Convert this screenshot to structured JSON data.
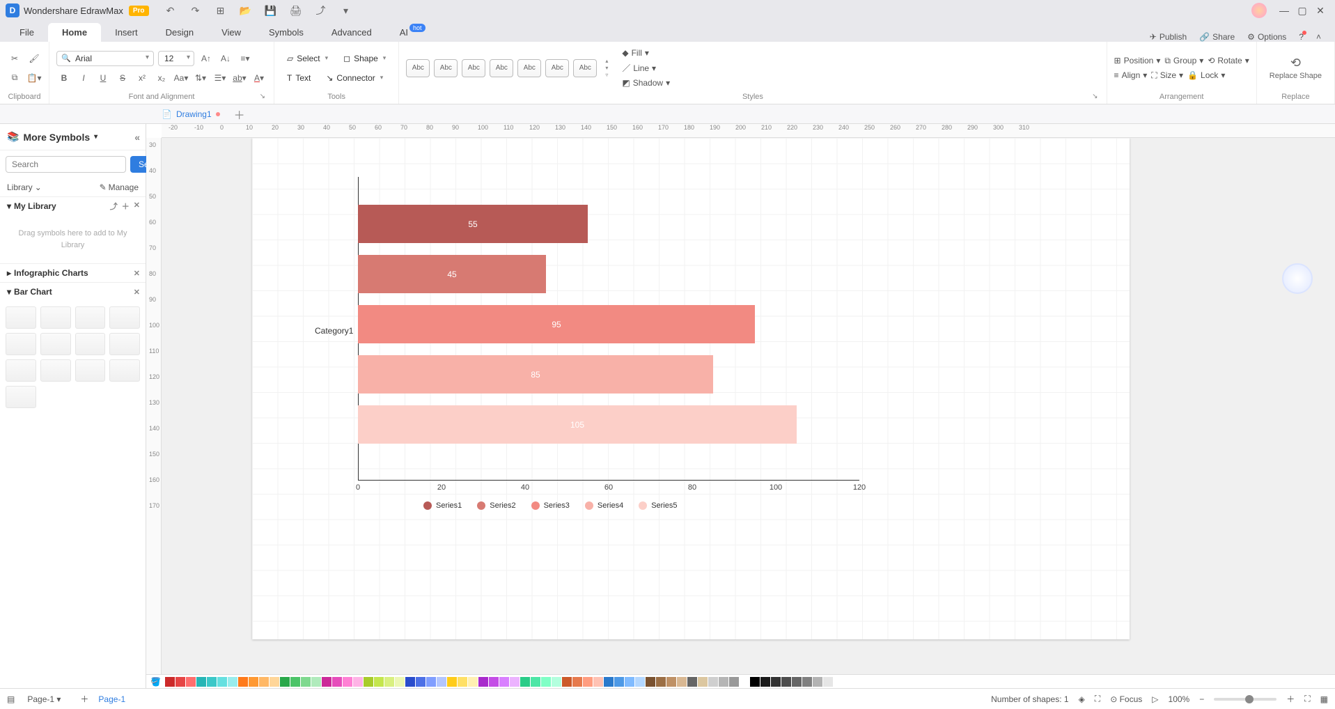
{
  "app": {
    "title": "Wondershare EdrawMax",
    "pro": "Pro"
  },
  "menu": {
    "file": "File",
    "home": "Home",
    "insert": "Insert",
    "design": "Design",
    "view": "View",
    "symbols": "Symbols",
    "advanced": "Advanced",
    "ai": "AI",
    "ai_badge": "hot",
    "publish": "Publish",
    "share": "Share",
    "options": "Options"
  },
  "ribbon": {
    "clipboard": "Clipboard",
    "font_name": "Arial",
    "font_size": "12",
    "font_group": "Font and Alignment",
    "select": "Select",
    "shape": "Shape",
    "text": "Text",
    "connector": "Connector",
    "tools": "Tools",
    "style_swatch": "Abc",
    "styles": "Styles",
    "fill": "Fill",
    "line": "Line",
    "shadow": "Shadow",
    "position": "Position",
    "group": "Group",
    "rotate": "Rotate",
    "align": "Align",
    "size": "Size",
    "lock": "Lock",
    "arrangement": "Arrangement",
    "replace_shape": "Replace Shape",
    "replace": "Replace"
  },
  "doc": {
    "name": "Drawing1"
  },
  "left": {
    "more_symbols": "More Symbols",
    "search_placeholder": "Search",
    "search_btn": "Search",
    "library": "Library",
    "manage": "Manage",
    "my_library": "My Library",
    "drop_hint": "Drag symbols here to add to My Library",
    "sec_info": "Infographic Charts",
    "sec_bar": "Bar Chart"
  },
  "ruler_h": [
    "-20",
    "-10",
    "0",
    "10",
    "20",
    "30",
    "40",
    "50",
    "60",
    "70",
    "80",
    "90",
    "100",
    "110",
    "120",
    "130",
    "140",
    "150",
    "160",
    "170",
    "180",
    "190",
    "200",
    "210",
    "220",
    "230",
    "240",
    "250",
    "260",
    "270",
    "280",
    "290",
    "300",
    "310"
  ],
  "ruler_v": [
    "30",
    "40",
    "50",
    "60",
    "70",
    "80",
    "90",
    "100",
    "110",
    "120",
    "130",
    "140",
    "150",
    "160",
    "170"
  ],
  "chart_data": {
    "type": "bar",
    "orientation": "horizontal",
    "category_label": "Category1",
    "x_ticks": [
      0,
      20,
      40,
      60,
      80,
      100,
      120
    ],
    "series": [
      {
        "name": "Series1",
        "value": 55,
        "color": "#b75a56"
      },
      {
        "name": "Series2",
        "value": 45,
        "color": "#d77a72"
      },
      {
        "name": "Series3",
        "value": 95,
        "color": "#f28a82"
      },
      {
        "name": "Series4",
        "value": 85,
        "color": "#f8b1a8"
      },
      {
        "name": "Series5",
        "value": 105,
        "color": "#fccfc8"
      }
    ],
    "xmax": 120
  },
  "palette": [
    "#cc2a2a",
    "#e64545",
    "#ff6e6e",
    "#26b5b5",
    "#3bc8c8",
    "#66e0e0",
    "#99eded",
    "#ff7a1a",
    "#ff9933",
    "#ffb866",
    "#ffd699",
    "#2aa84a",
    "#4cc468",
    "#7fd98f",
    "#b0ebbc",
    "#cc2a99",
    "#e64dbb",
    "#ff80d4",
    "#ffb3e6",
    "#a8cc2a",
    "#c4e64d",
    "#d9f080",
    "#ecf7b3",
    "#2a4dcc",
    "#4d70e6",
    "#809eff",
    "#b3c6ff",
    "#ffcc1a",
    "#ffe066",
    "#fff0b3",
    "#a82acc",
    "#c44de6",
    "#d980ff",
    "#ecb3ff",
    "#2acc88",
    "#4de6a6",
    "#80ffc6",
    "#b3ffde",
    "#cc5a2a",
    "#e67a4d",
    "#ff9d80",
    "#ffc2b3",
    "#2a7acc",
    "#4d99e6",
    "#80bbff",
    "#b3d7ff",
    "#7a5230",
    "#9c6f45",
    "#bf9166",
    "#d9b893",
    "#666666",
    "#dcc7a0",
    "#cfcfcf",
    "#b5b5b5",
    "#999999",
    "#ffffff",
    "#000000",
    "#1a1a1a",
    "#333333",
    "#4d4d4d",
    "#666666",
    "#808080",
    "#b3b3b3",
    "#e6e6e6"
  ],
  "status": {
    "page_sel": "Page-1",
    "page_tab": "Page-1",
    "shapes_label": "Number of shapes:",
    "shapes_count": "1",
    "focus": "Focus",
    "zoom": "100%"
  }
}
